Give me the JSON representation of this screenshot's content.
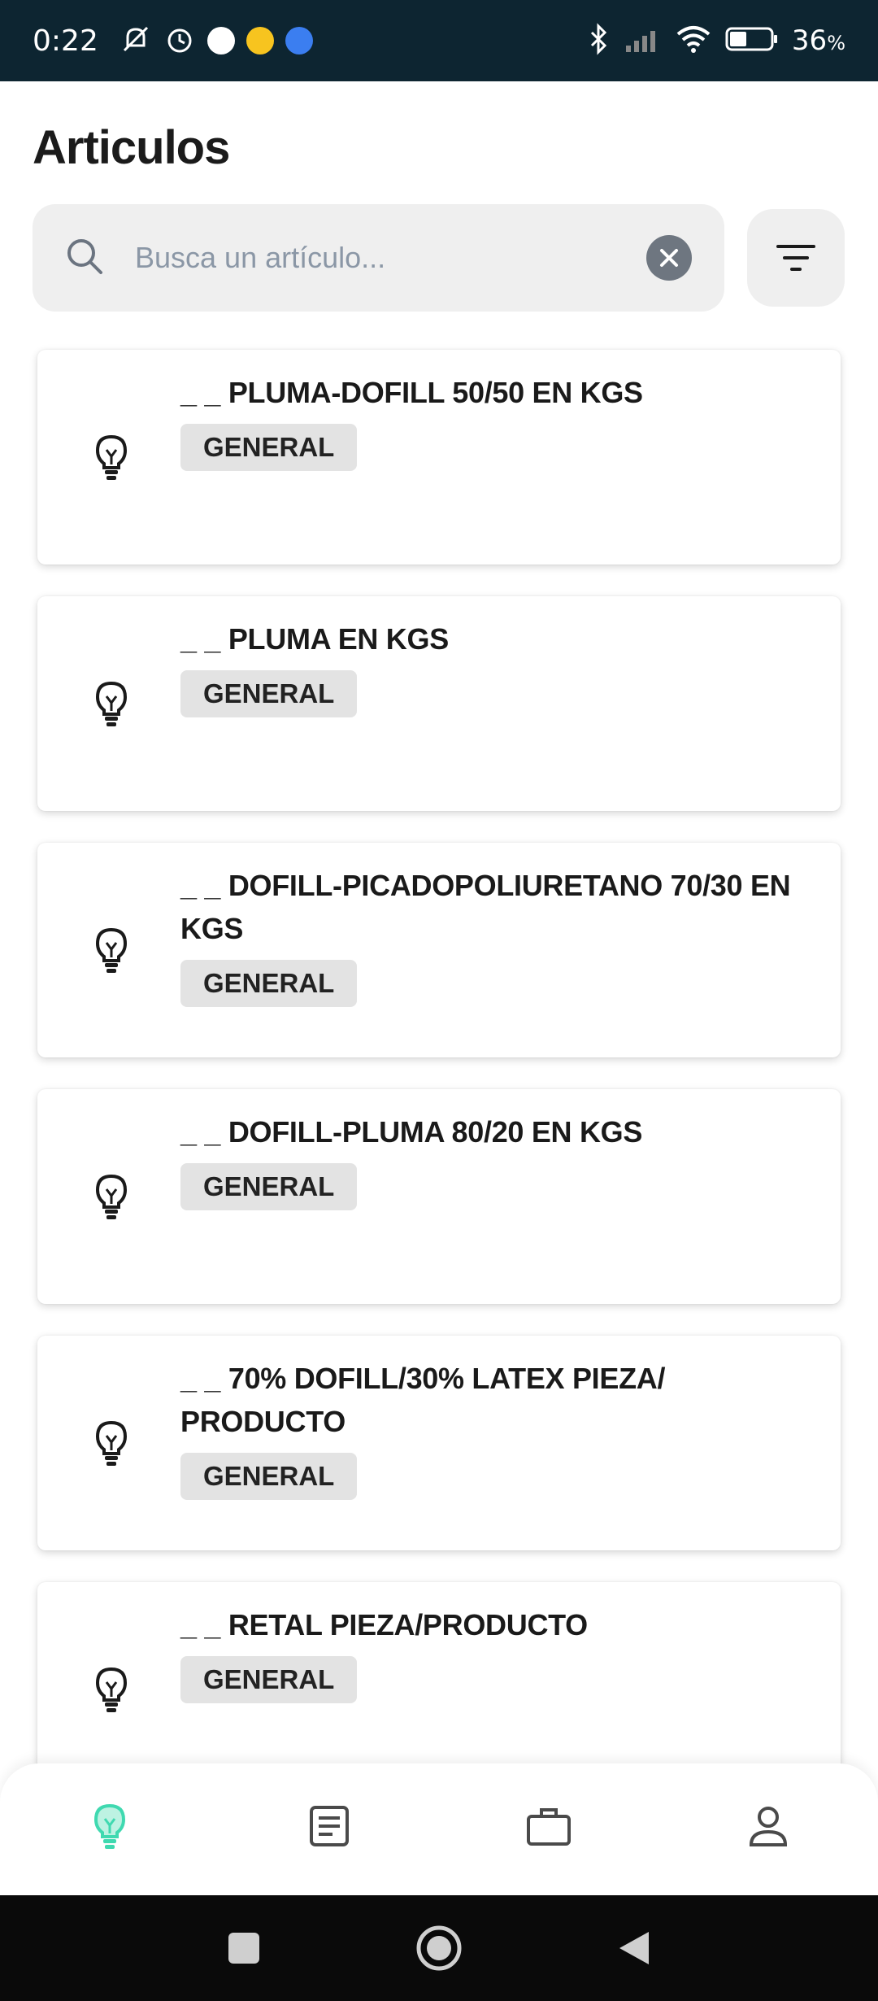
{
  "status_bar": {
    "time": "0:22",
    "battery": "36",
    "battery_unit": "%"
  },
  "header": {
    "title": "Articulos"
  },
  "search": {
    "placeholder": "Busca un artículo...",
    "value": ""
  },
  "items": [
    {
      "title": "_ _ PLUMA-DOFILL 50/50 EN KGS",
      "badge": "GENERAL"
    },
    {
      "title": "_ _ PLUMA EN KGS",
      "badge": "GENERAL"
    },
    {
      "title": "_ _ DOFILL-PICADOPOLIURETANO 70/30 EN KGS",
      "badge": "GENERAL"
    },
    {
      "title": "_ _ DOFILL-PLUMA 80/20 EN KGS",
      "badge": "GENERAL"
    },
    {
      "title": "_ _ 70% DOFILL/30% LATEX PIEZA/ PRODUCTO",
      "badge": "GENERAL"
    },
    {
      "title": "_ _ RETAL PIEZA/PRODUCTO",
      "badge": "GENERAL"
    }
  ],
  "bottom_nav": {
    "items": [
      {
        "icon": "lightbulb-icon",
        "active": true
      },
      {
        "icon": "document-icon",
        "active": false
      },
      {
        "icon": "briefcase-icon",
        "active": false
      },
      {
        "icon": "person-icon",
        "active": false
      }
    ],
    "active_color": "#3fd9b0"
  },
  "colors": {
    "status_bar_bg": "#0d2531",
    "search_bg": "#efefef",
    "badge_bg": "#e3e3e3"
  }
}
